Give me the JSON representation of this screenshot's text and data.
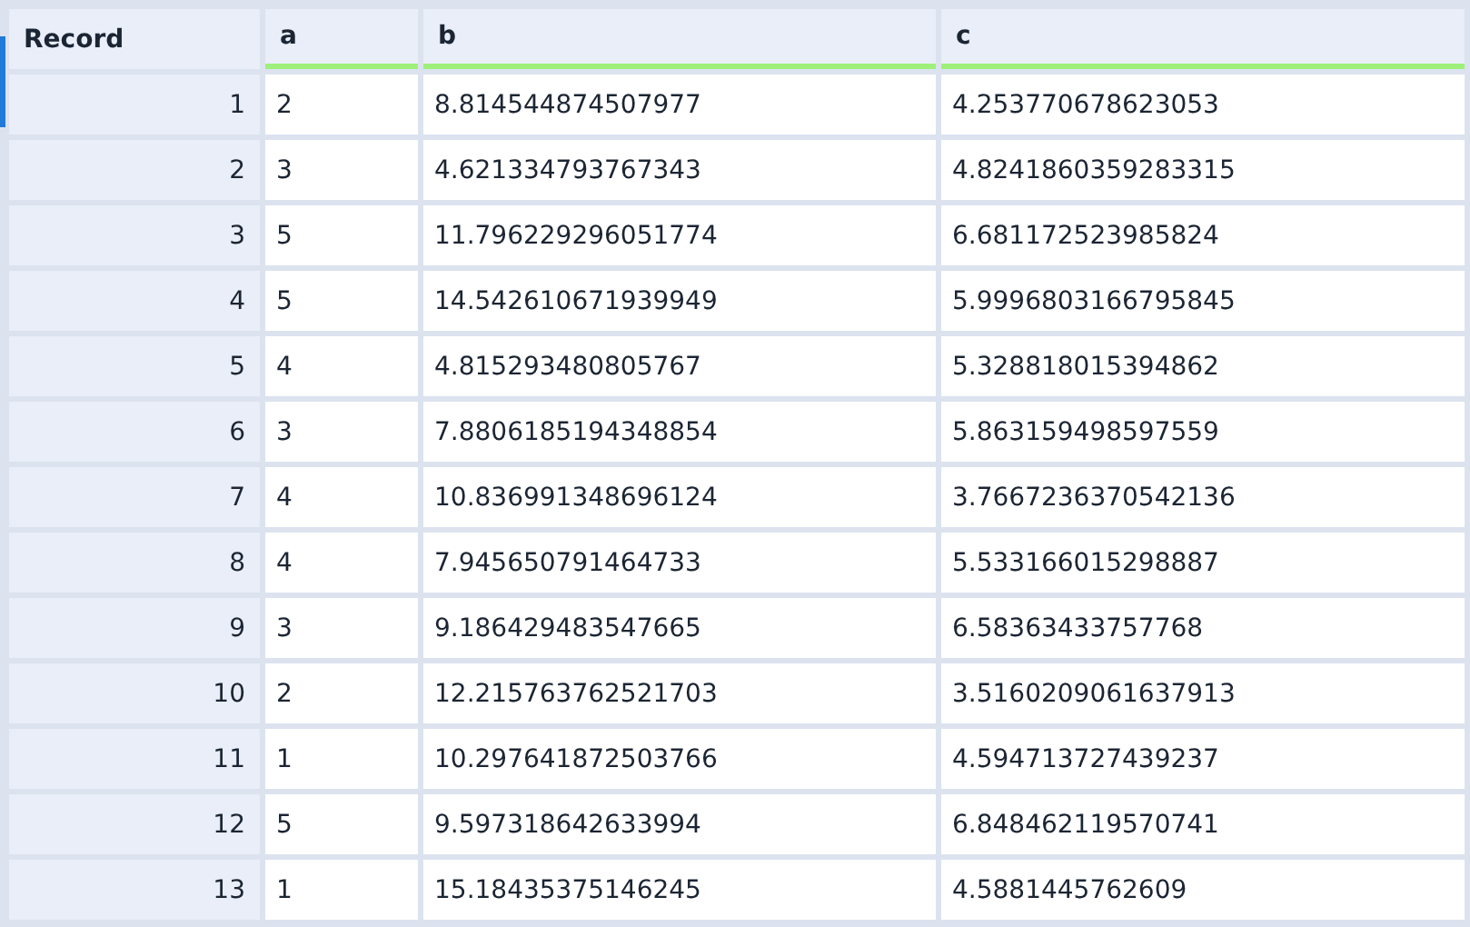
{
  "table": {
    "columns": [
      "Record",
      "a",
      "b",
      "c"
    ],
    "rows": [
      {
        "record": "1",
        "a": "2",
        "b": "8.814544874507977",
        "c": "4.253770678623053"
      },
      {
        "record": "2",
        "a": "3",
        "b": "4.621334793767343",
        "c": "4.8241860359283315"
      },
      {
        "record": "3",
        "a": "5",
        "b": "11.796229296051774",
        "c": "6.681172523985824"
      },
      {
        "record": "4",
        "a": "5",
        "b": "14.542610671939949",
        "c": "5.9996803166795845"
      },
      {
        "record": "5",
        "a": "4",
        "b": "4.815293480805767",
        "c": "5.328818015394862"
      },
      {
        "record": "6",
        "a": "3",
        "b": "7.8806185194348854",
        "c": "5.863159498597559"
      },
      {
        "record": "7",
        "a": "4",
        "b": "10.836991348696124",
        "c": "3.7667236370542136"
      },
      {
        "record": "8",
        "a": "4",
        "b": "7.945650791464733",
        "c": "5.533166015298887"
      },
      {
        "record": "9",
        "a": "3",
        "b": "9.186429483547665",
        "c": "6.58363433757768"
      },
      {
        "record": "10",
        "a": "2",
        "b": "12.215763762521703",
        "c": "3.5160209061637913"
      },
      {
        "record": "11",
        "a": "1",
        "b": "10.297641872503766",
        "c": "4.594713727439237"
      },
      {
        "record": "12",
        "a": "5",
        "b": "9.597318642633994",
        "c": "6.848462119570741"
      },
      {
        "record": "13",
        "a": "1",
        "b": "15.18435375146245",
        "c": "4.5881445762609"
      }
    ]
  }
}
